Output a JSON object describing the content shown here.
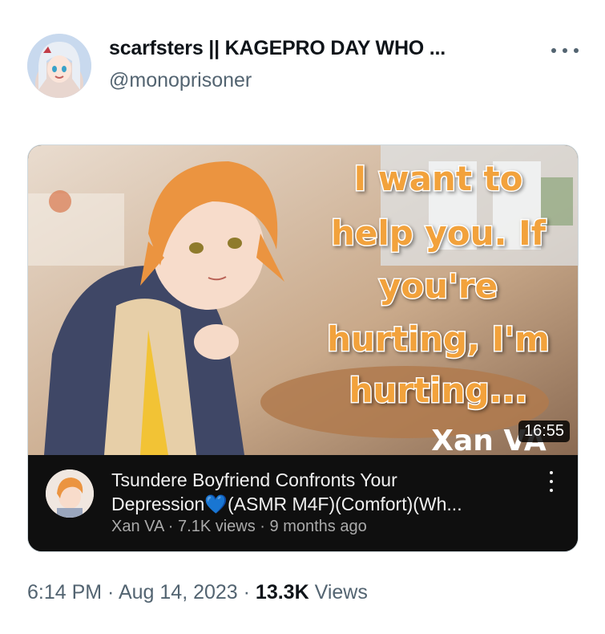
{
  "author": {
    "display_name": "scarfsters || KAGEPRO DAY WHO ...",
    "handle": "@monoprisoner"
  },
  "video": {
    "thumbnail_text": [
      "I want to",
      "help you. If",
      "you're",
      "hurting, I'm",
      "hurting..."
    ],
    "thumbnail_watermark": "Xan VA",
    "duration": "16:55",
    "title_line1": "Tsundere Boyfriend Confronts Your",
    "title_line2_start": "Depression",
    "title_heart": "💙",
    "title_line2_end": "(ASMR M4F)(Comfort)(Wh...",
    "channel": "Xan VA",
    "views": "7.1K views",
    "age": "9 months ago"
  },
  "post_meta": {
    "time": "6:14 PM",
    "date": "Aug 14, 2023",
    "views_count": "13.3K",
    "views_label": "Views"
  },
  "colors": {
    "caption_fill": "#f2a23c",
    "caption_stroke": "#ffffff",
    "link_blue": "#3a8dde"
  }
}
